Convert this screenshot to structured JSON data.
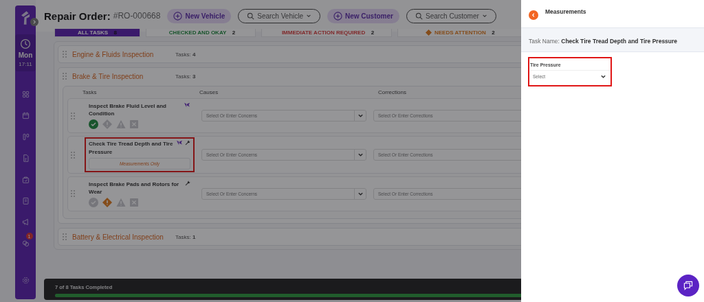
{
  "sidebar": {
    "day": "Mon",
    "time": "17:11",
    "notification_count": "1"
  },
  "header": {
    "title": "Repair Order:",
    "order_number": "#RO-000668",
    "buttons": [
      {
        "label": "New Vehicle",
        "kind": "add"
      },
      {
        "label": "Search Vehicle",
        "kind": "search"
      },
      {
        "label": "New Customer",
        "kind": "add"
      },
      {
        "label": "Search Customer",
        "kind": "search"
      }
    ]
  },
  "filters": [
    {
      "label": "ALL TASKS",
      "count": "8",
      "kind": "all",
      "selected": true
    },
    {
      "label": "CHECKED AND OKAY",
      "count": "2",
      "kind": "okay",
      "selected": false
    },
    {
      "label": "IMMEDIATE ACTION REQUIRED",
      "count": "2",
      "kind": "urgent",
      "selected": false
    },
    {
      "label": "NEEDS ATTENTION",
      "count": "2",
      "kind": "attention",
      "selected": false
    }
  ],
  "sections": [
    {
      "name": "Engine & Fluids Inspection",
      "tasks_label": "Tasks:",
      "count": "4",
      "expanded": false
    },
    {
      "name": "Brake & Tire Inspection",
      "tasks_label": "Tasks:",
      "count": "3",
      "expanded": true,
      "columns": [
        "Tasks",
        "Causes",
        "Corrections"
      ],
      "tasks": [
        {
          "name": "Inspect Brake Fluid Level and Condition",
          "flag": true,
          "wrench": false,
          "kind": "status",
          "status_icons": [
            {
              "kind": "okay",
              "selected": true
            },
            {
              "kind": "attention",
              "selected": false
            },
            {
              "kind": "urgent",
              "selected": false
            },
            {
              "kind": "na",
              "selected": false
            }
          ],
          "highlighted": false,
          "causes_placeholder": "Select Or Enter Concerns",
          "corrections_placeholder": "Select Or Enter Corrections"
        },
        {
          "name": "Check Tire Tread Depth and Tire Pressure",
          "flag": true,
          "wrench": true,
          "kind": "measurement",
          "note": "Measurements Only",
          "highlighted": true,
          "causes_placeholder": "Select Or Enter Concerns",
          "corrections_placeholder": "Select Or Enter Corrections"
        },
        {
          "name": "Inspect Brake Pads and Rotors for Wear",
          "flag": false,
          "wrench": true,
          "kind": "status",
          "status_icons": [
            {
              "kind": "okay",
              "selected": false
            },
            {
              "kind": "attention",
              "selected": true
            },
            {
              "kind": "urgent",
              "selected": false
            },
            {
              "kind": "na",
              "selected": false
            }
          ],
          "highlighted": false,
          "causes_placeholder": "Select Or Enter Concerns",
          "corrections_placeholder": "Select Or Enter Corrections"
        }
      ]
    },
    {
      "name": "Battery & Electrical Inspection",
      "tasks_label": "Tasks:",
      "count": "1",
      "expanded": false
    }
  ],
  "footer": {
    "progress_text": "7 of 8 Tasks Completed",
    "level": 0.875
  },
  "drawer": {
    "title": "Measurements",
    "task_label": "Task Name:",
    "task_name": "Check Tire Tread Depth and Tire Pressure",
    "fields": [
      {
        "label": "Tire Pressure",
        "placeholder": "Select",
        "highlighted": true
      }
    ]
  }
}
